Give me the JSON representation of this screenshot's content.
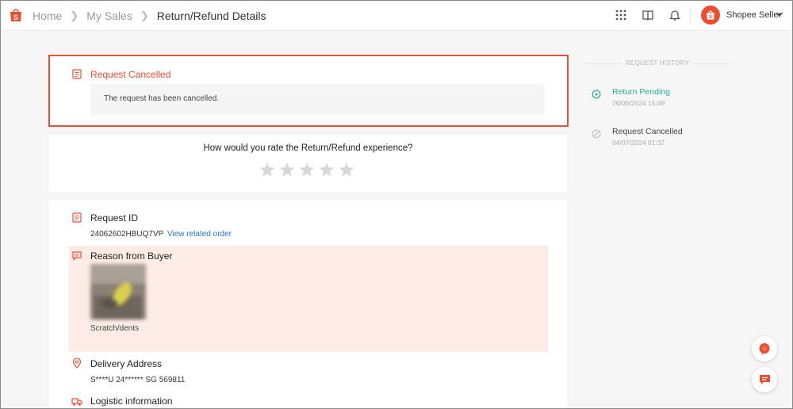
{
  "header": {
    "breadcrumbs": [
      "Home",
      "My Sales",
      "Return/Refund Details"
    ],
    "seller_name": "Shopee Seller",
    "icons": [
      "apps-grid-icon",
      "book-icon",
      "bell-icon"
    ]
  },
  "status_card": {
    "title": "Request Cancelled",
    "message": "The request has been cancelled."
  },
  "rating": {
    "question": "How would you rate the Return/Refund experience?",
    "stars_total": 5,
    "stars_selected": 0
  },
  "details": {
    "request_id_label": "Request ID",
    "request_id": "24062602HBUQ7VP",
    "view_order_link": "View related order",
    "reason_label": "Reason from Buyer",
    "reason": "Scratch/dents",
    "delivery_label": "Delivery Address",
    "delivery_address": "S****U 24****** SG 569811",
    "logistic_label": "Logistic information"
  },
  "history": {
    "heading": "REQUEST HISTORY",
    "events": [
      {
        "status": "Return Pending",
        "time": "26/06/2024 15:49"
      },
      {
        "status": "Request Cancelled",
        "time": "04/07/2024 01:37"
      }
    ]
  },
  "colors": {
    "brand": "#ee4d2d",
    "link": "#2673dd",
    "pending": "#26aa99",
    "reason_bg": "#fdebe5"
  }
}
